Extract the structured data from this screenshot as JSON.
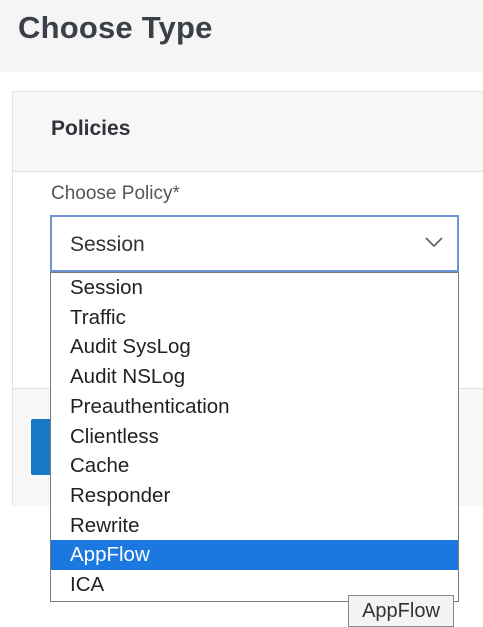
{
  "page": {
    "title": "Choose Type"
  },
  "panel": {
    "header": "Policies"
  },
  "field": {
    "label": "Choose Policy*",
    "selected_value": "Session"
  },
  "dropdown": {
    "options": [
      "Session",
      "Traffic",
      "Audit SysLog",
      "Audit NSLog",
      "Preauthentication",
      "Clientless",
      "Cache",
      "Responder",
      "Rewrite",
      "AppFlow",
      "ICA"
    ],
    "highlighted": "AppFlow"
  },
  "tooltip": {
    "text": "AppFlow"
  },
  "colors": {
    "accent": "#1a78e0",
    "button": "#1a78c8",
    "focus_border": "#6c93d6"
  },
  "icons": {
    "select_arrow": "chevron-down-icon"
  }
}
